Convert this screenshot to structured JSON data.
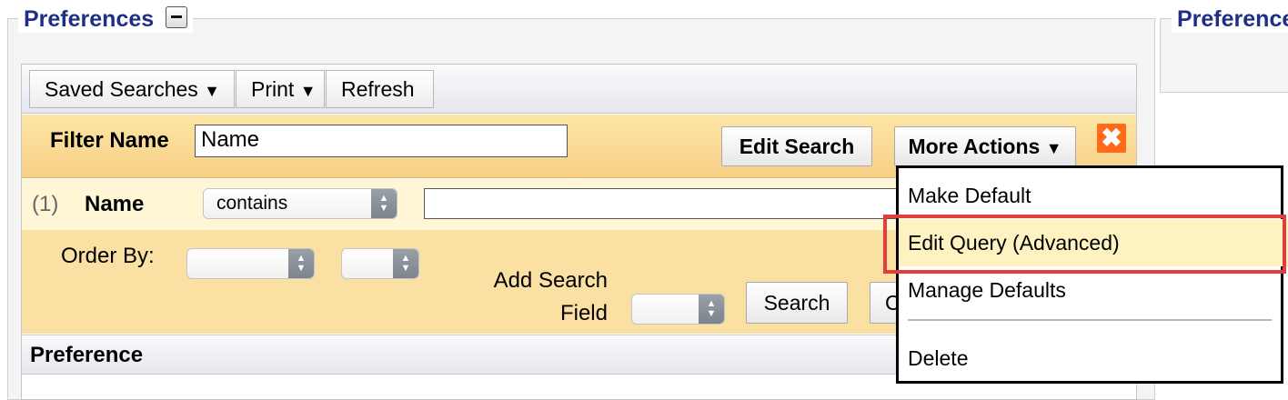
{
  "left_panel": {
    "legend": "Preferences"
  },
  "right_panel": {
    "legend": "Preference"
  },
  "toolbar": {
    "saved_searches": "Saved Searches",
    "print": "Print",
    "refresh": "Refresh",
    "dropdown_arrow": "▼"
  },
  "filter": {
    "label": "Filter Name",
    "value": "Name",
    "edit_search": "Edit Search",
    "more_actions": "More Actions",
    "close_glyph": "✖"
  },
  "criteria": {
    "index": "(1)",
    "field": "Name",
    "operator": "contains",
    "value": ""
  },
  "order": {
    "label": "Order By:",
    "add_search_line1": "Add Search",
    "add_search_line2": "Field",
    "search_button": "Search",
    "partial_button": "C"
  },
  "grid": {
    "column_header": "Preference"
  },
  "menu": {
    "items": [
      "Make Default",
      "Edit Query (Advanced)",
      "Manage Defaults",
      "Delete"
    ],
    "highlighted": "Edit Query (Advanced)"
  },
  "colors": {
    "legend": "#1f2f86",
    "filter_bar": "#f7cf86",
    "highlight_outline": "#e23c3c",
    "close_button": "#ff6b1a"
  }
}
